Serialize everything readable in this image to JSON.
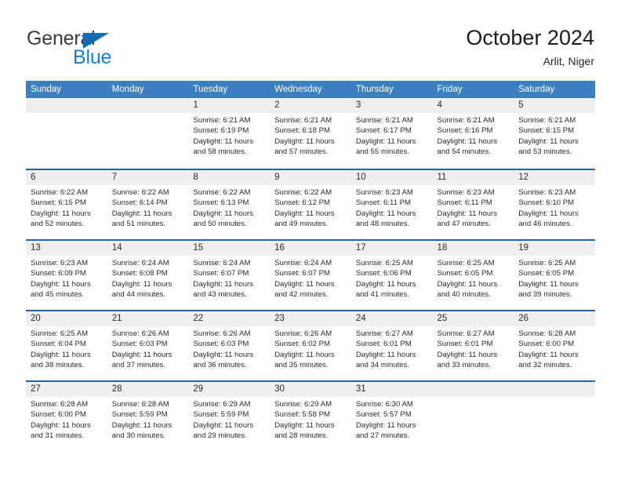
{
  "brand": {
    "line1": "General",
    "line2": "Blue",
    "triangle_color": "#146cb4",
    "line2_color": "#1a7fd4"
  },
  "header": {
    "title": "October 2024",
    "subtitle": "Arlit, Niger"
  },
  "theme": {
    "header_bar": "#3c7fc0",
    "week_divider": "#2166ac",
    "date_strip": "#efefef",
    "text": "#2b2b2b"
  },
  "weekdays": [
    "Sunday",
    "Monday",
    "Tuesday",
    "Wednesday",
    "Thursday",
    "Friday",
    "Saturday"
  ],
  "weeks": [
    [
      {
        "date": "",
        "sunrise": "",
        "sunset": "",
        "daylight1": "",
        "daylight2": ""
      },
      {
        "date": "",
        "sunrise": "",
        "sunset": "",
        "daylight1": "",
        "daylight2": ""
      },
      {
        "date": "1",
        "sunrise": "Sunrise: 6:21 AM",
        "sunset": "Sunset: 6:19 PM",
        "daylight1": "Daylight: 11 hours",
        "daylight2": "and 58 minutes."
      },
      {
        "date": "2",
        "sunrise": "Sunrise: 6:21 AM",
        "sunset": "Sunset: 6:18 PM",
        "daylight1": "Daylight: 11 hours",
        "daylight2": "and 57 minutes."
      },
      {
        "date": "3",
        "sunrise": "Sunrise: 6:21 AM",
        "sunset": "Sunset: 6:17 PM",
        "daylight1": "Daylight: 11 hours",
        "daylight2": "and 55 minutes."
      },
      {
        "date": "4",
        "sunrise": "Sunrise: 6:21 AM",
        "sunset": "Sunset: 6:16 PM",
        "daylight1": "Daylight: 11 hours",
        "daylight2": "and 54 minutes."
      },
      {
        "date": "5",
        "sunrise": "Sunrise: 6:21 AM",
        "sunset": "Sunset: 6:15 PM",
        "daylight1": "Daylight: 11 hours",
        "daylight2": "and 53 minutes."
      }
    ],
    [
      {
        "date": "6",
        "sunrise": "Sunrise: 6:22 AM",
        "sunset": "Sunset: 6:15 PM",
        "daylight1": "Daylight: 11 hours",
        "daylight2": "and 52 minutes."
      },
      {
        "date": "7",
        "sunrise": "Sunrise: 6:22 AM",
        "sunset": "Sunset: 6:14 PM",
        "daylight1": "Daylight: 11 hours",
        "daylight2": "and 51 minutes."
      },
      {
        "date": "8",
        "sunrise": "Sunrise: 6:22 AM",
        "sunset": "Sunset: 6:13 PM",
        "daylight1": "Daylight: 11 hours",
        "daylight2": "and 50 minutes."
      },
      {
        "date": "9",
        "sunrise": "Sunrise: 6:22 AM",
        "sunset": "Sunset: 6:12 PM",
        "daylight1": "Daylight: 11 hours",
        "daylight2": "and 49 minutes."
      },
      {
        "date": "10",
        "sunrise": "Sunrise: 6:23 AM",
        "sunset": "Sunset: 6:11 PM",
        "daylight1": "Daylight: 11 hours",
        "daylight2": "and 48 minutes."
      },
      {
        "date": "11",
        "sunrise": "Sunrise: 6:23 AM",
        "sunset": "Sunset: 6:11 PM",
        "daylight1": "Daylight: 11 hours",
        "daylight2": "and 47 minutes."
      },
      {
        "date": "12",
        "sunrise": "Sunrise: 6:23 AM",
        "sunset": "Sunset: 6:10 PM",
        "daylight1": "Daylight: 11 hours",
        "daylight2": "and 46 minutes."
      }
    ],
    [
      {
        "date": "13",
        "sunrise": "Sunrise: 6:23 AM",
        "sunset": "Sunset: 6:09 PM",
        "daylight1": "Daylight: 11 hours",
        "daylight2": "and 45 minutes."
      },
      {
        "date": "14",
        "sunrise": "Sunrise: 6:24 AM",
        "sunset": "Sunset: 6:08 PM",
        "daylight1": "Daylight: 11 hours",
        "daylight2": "and 44 minutes."
      },
      {
        "date": "15",
        "sunrise": "Sunrise: 6:24 AM",
        "sunset": "Sunset: 6:07 PM",
        "daylight1": "Daylight: 11 hours",
        "daylight2": "and 43 minutes."
      },
      {
        "date": "16",
        "sunrise": "Sunrise: 6:24 AM",
        "sunset": "Sunset: 6:07 PM",
        "daylight1": "Daylight: 11 hours",
        "daylight2": "and 42 minutes."
      },
      {
        "date": "17",
        "sunrise": "Sunrise: 6:25 AM",
        "sunset": "Sunset: 6:06 PM",
        "daylight1": "Daylight: 11 hours",
        "daylight2": "and 41 minutes."
      },
      {
        "date": "18",
        "sunrise": "Sunrise: 6:25 AM",
        "sunset": "Sunset: 6:05 PM",
        "daylight1": "Daylight: 11 hours",
        "daylight2": "and 40 minutes."
      },
      {
        "date": "19",
        "sunrise": "Sunrise: 6:25 AM",
        "sunset": "Sunset: 6:05 PM",
        "daylight1": "Daylight: 11 hours",
        "daylight2": "and 39 minutes."
      }
    ],
    [
      {
        "date": "20",
        "sunrise": "Sunrise: 6:25 AM",
        "sunset": "Sunset: 6:04 PM",
        "daylight1": "Daylight: 11 hours",
        "daylight2": "and 38 minutes."
      },
      {
        "date": "21",
        "sunrise": "Sunrise: 6:26 AM",
        "sunset": "Sunset: 6:03 PM",
        "daylight1": "Daylight: 11 hours",
        "daylight2": "and 37 minutes."
      },
      {
        "date": "22",
        "sunrise": "Sunrise: 6:26 AM",
        "sunset": "Sunset: 6:03 PM",
        "daylight1": "Daylight: 11 hours",
        "daylight2": "and 36 minutes."
      },
      {
        "date": "23",
        "sunrise": "Sunrise: 6:26 AM",
        "sunset": "Sunset: 6:02 PM",
        "daylight1": "Daylight: 11 hours",
        "daylight2": "and 35 minutes."
      },
      {
        "date": "24",
        "sunrise": "Sunrise: 6:27 AM",
        "sunset": "Sunset: 6:01 PM",
        "daylight1": "Daylight: 11 hours",
        "daylight2": "and 34 minutes."
      },
      {
        "date": "25",
        "sunrise": "Sunrise: 6:27 AM",
        "sunset": "Sunset: 6:01 PM",
        "daylight1": "Daylight: 11 hours",
        "daylight2": "and 33 minutes."
      },
      {
        "date": "26",
        "sunrise": "Sunrise: 6:28 AM",
        "sunset": "Sunset: 6:00 PM",
        "daylight1": "Daylight: 11 hours",
        "daylight2": "and 32 minutes."
      }
    ],
    [
      {
        "date": "27",
        "sunrise": "Sunrise: 6:28 AM",
        "sunset": "Sunset: 6:00 PM",
        "daylight1": "Daylight: 11 hours",
        "daylight2": "and 31 minutes."
      },
      {
        "date": "28",
        "sunrise": "Sunrise: 6:28 AM",
        "sunset": "Sunset: 5:59 PM",
        "daylight1": "Daylight: 11 hours",
        "daylight2": "and 30 minutes."
      },
      {
        "date": "29",
        "sunrise": "Sunrise: 6:29 AM",
        "sunset": "Sunset: 5:59 PM",
        "daylight1": "Daylight: 11 hours",
        "daylight2": "and 29 minutes."
      },
      {
        "date": "30",
        "sunrise": "Sunrise: 6:29 AM",
        "sunset": "Sunset: 5:58 PM",
        "daylight1": "Daylight: 11 hours",
        "daylight2": "and 28 minutes."
      },
      {
        "date": "31",
        "sunrise": "Sunrise: 6:30 AM",
        "sunset": "Sunset: 5:57 PM",
        "daylight1": "Daylight: 11 hours",
        "daylight2": "and 27 minutes."
      },
      {
        "date": "",
        "sunrise": "",
        "sunset": "",
        "daylight1": "",
        "daylight2": ""
      },
      {
        "date": "",
        "sunrise": "",
        "sunset": "",
        "daylight1": "",
        "daylight2": ""
      }
    ]
  ]
}
